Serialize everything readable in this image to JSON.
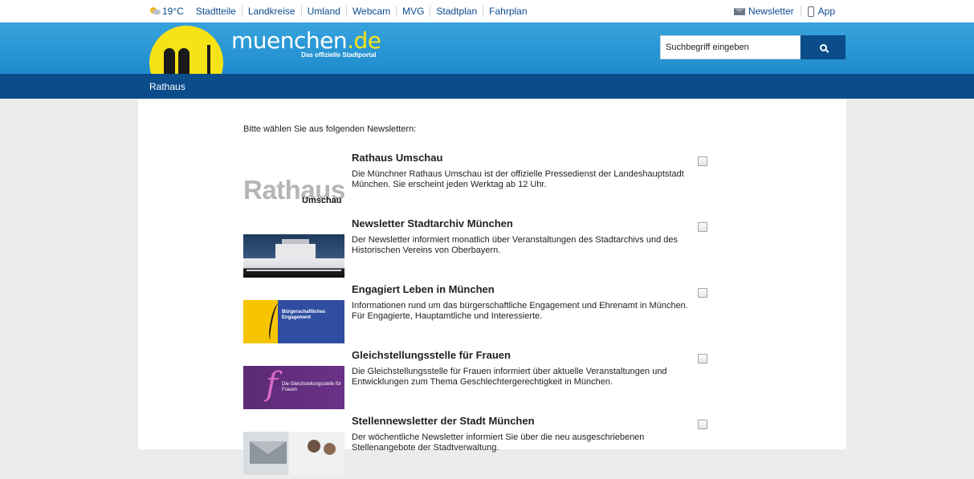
{
  "topbar": {
    "weather": "19°C",
    "links": [
      "Stadtteile",
      "Landkreise",
      "Umland",
      "Webcam",
      "MVG",
      "Stadtplan",
      "Fahrplan"
    ],
    "newsletter": "Newsletter",
    "app": "App"
  },
  "header": {
    "brand_main": "muenchen",
    "brand_dot": ".de",
    "tagline": "Das offizielle Stadtportal",
    "search_placeholder": "Suchbegriff eingeben"
  },
  "nav": {
    "breadcrumb": "Rathaus"
  },
  "content": {
    "intro": "Bitte wählen Sie aus folgenden Newslettern:",
    "thumb_rathaus_big": "Rathaus",
    "thumb_rathaus_small": "Umschau",
    "thumb_engage": "Bürgerschaftliches Engagement",
    "thumb_gleich": "Die Gleichstellungsstelle für Frauen",
    "newsletters": [
      {
        "title": "Rathaus Umschau",
        "desc": "Die Münchner Rathaus Umschau ist der offizielle Pressedienst der Landeshauptstadt München. Sie erscheint jeden Werktag ab 12 Uhr."
      },
      {
        "title": "Newsletter Stadtarchiv München",
        "desc": "Der Newsletter informiert monatlich über Veranstaltungen des Stadtarchivs und des Historischen Vereins von Oberbayern."
      },
      {
        "title": "Engagiert Leben in München",
        "desc": "Informationen rund um das bürgerschaftliche Engagement und Ehrenamt in München. Für Engagierte, Hauptamtliche und Interessierte."
      },
      {
        "title": "Gleichstellungsstelle für Frauen",
        "desc": "Die Gleichstellungsstelle für Frauen informiert über aktuelle Veranstaltungen und Entwicklungen zum Thema Geschlechtergerechtigkeit in München."
      },
      {
        "title": "Stellennewsletter der Stadt München",
        "desc": "Der wöchentliche Newsletter informiert Sie über die neu ausgeschriebenen Stellenangebote der Stadtverwaltung."
      }
    ]
  },
  "colors": {
    "header": "#2596d6",
    "nav": "#0b4d8a",
    "link": "#0b4a8e",
    "sun": "#f7e315"
  }
}
